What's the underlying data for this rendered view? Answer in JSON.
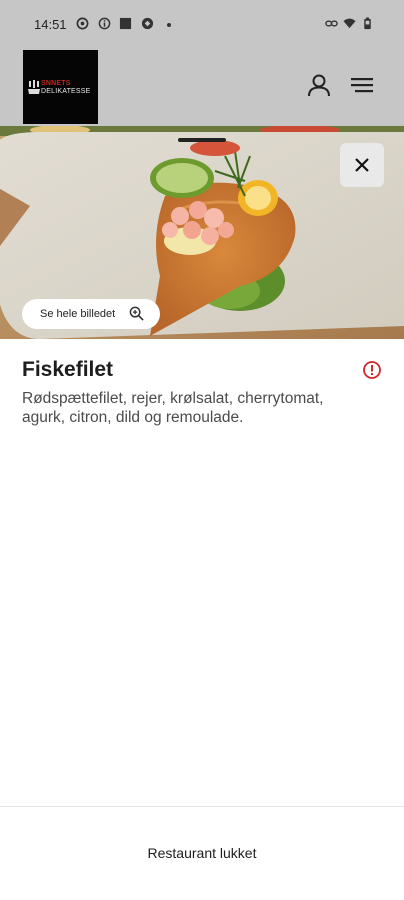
{
  "status_bar": {
    "time": "14:51",
    "icons": [
      "chat-icon",
      "info-icon",
      "square-icon",
      "sync-icon",
      "link-icon",
      "wifi-icon",
      "battery-icon"
    ]
  },
  "header": {
    "logo_line1": "SNNETS",
    "logo_line2": "DELIKATESSE",
    "icons": [
      "user-icon",
      "menu-icon"
    ]
  },
  "hero": {
    "see_full_image_label": "Se hele billedet"
  },
  "dish": {
    "title": "Fiskefilet",
    "description": "Rødspættefilet, rejer, krølsalat, cherrytomat, agurk, citron, dild og remoulade."
  },
  "footer": {
    "status_label": "Restaurant lukket"
  },
  "colors": {
    "header_bg": "#c6c6c6",
    "accent_red": "#d0272a",
    "close_bg": "#e9e9e9"
  }
}
